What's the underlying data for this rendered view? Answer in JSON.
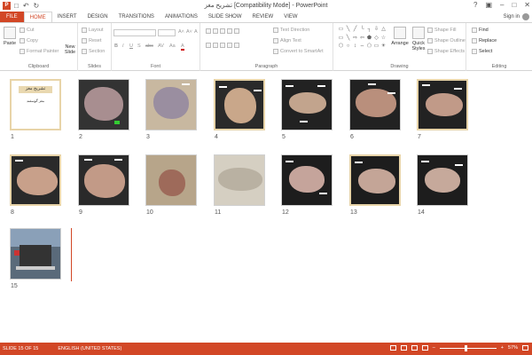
{
  "window": {
    "title": "تشریح مغز [Compatibility Mode] - PowerPoint",
    "app_letter": "P"
  },
  "qat": {
    "save_icon": "□",
    "undo_icon": "↶",
    "redo_icon": "↻"
  },
  "winctl": {
    "help": "?",
    "restore": "▣",
    "minimize": "–",
    "maximize": "□",
    "close": "✕"
  },
  "tabs": [
    "FILE",
    "HOME",
    "INSERT",
    "DESIGN",
    "TRANSITIONS",
    "ANIMATIONS",
    "SLIDE SHOW",
    "REVIEW",
    "VIEW"
  ],
  "signin": "Sign in",
  "ribbon": {
    "clipboard": {
      "paste": "Paste",
      "cut": "Cut",
      "copy": "Copy",
      "format_painter": "Format Painter",
      "label": "Clipboard"
    },
    "slides": {
      "new_slide": "New",
      "new_slide2": "Slide",
      "layout": "Layout",
      "reset": "Reset",
      "section": "Section",
      "label": "Slides"
    },
    "font": {
      "label": "Font",
      "grow": "A˄",
      "shrink": "A˅",
      "clear": "A",
      "bold": "B",
      "italic": "I",
      "underline": "U",
      "shadow": "S",
      "strike": "abc",
      "spacing": "AV",
      "case": "Aa",
      "color": "A"
    },
    "paragraph": {
      "text_direction": "Text Direction",
      "align_text": "Align Text",
      "convert": "Convert to SmartArt",
      "label": "Paragraph"
    },
    "drawing": {
      "arrange": "Arrange",
      "quick": "Quick",
      "styles": "Styles",
      "shape_fill": "Shape Fill",
      "shape_outline": "Shape Outline",
      "shape_effects": "Shape Effects",
      "label": "Drawing"
    },
    "editing": {
      "find": "Find",
      "replace": "Replace",
      "select": "Select",
      "label": "Editing"
    }
  },
  "shapes": [
    "▭",
    "╲",
    "╱",
    "└",
    "┐",
    "⇩",
    "△",
    "▭",
    "╲",
    "⇨",
    "⇦",
    "⬟",
    "◇",
    "☆",
    "⬡",
    "○",
    "↕",
    "⇔",
    "⬠",
    "▭",
    "☀"
  ],
  "slides": [
    {
      "num": "1"
    },
    {
      "num": "2"
    },
    {
      "num": "3"
    },
    {
      "num": "4"
    },
    {
      "num": "5"
    },
    {
      "num": "6"
    },
    {
      "num": "7"
    },
    {
      "num": "8"
    },
    {
      "num": "9"
    },
    {
      "num": "10"
    },
    {
      "num": "11"
    },
    {
      "num": "12"
    },
    {
      "num": "13"
    },
    {
      "num": "14"
    },
    {
      "num": "15"
    }
  ],
  "slide1": {
    "title": "تشریح مغز",
    "body": "مغز گوسفند"
  },
  "status": {
    "slide": "SLIDE 15 OF 15",
    "language": "ENGLISH (UNITED STATES)",
    "zoom": "57%",
    "zoom_out": "–",
    "zoom_in": "+"
  }
}
